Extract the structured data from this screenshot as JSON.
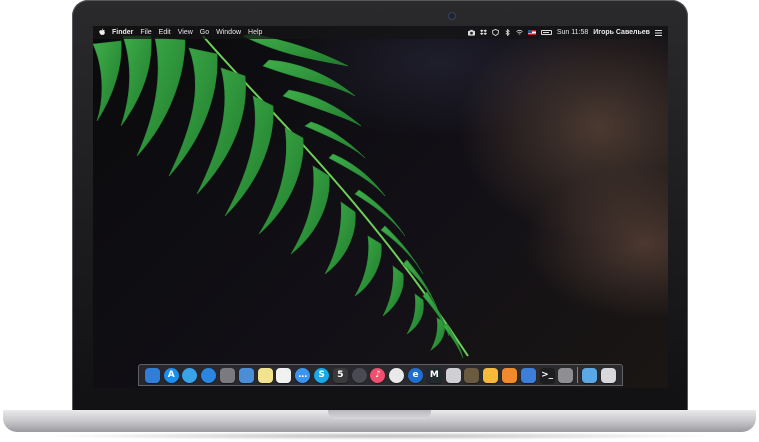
{
  "menubar": {
    "app_name": "Finder",
    "menus": [
      "File",
      "Edit",
      "View",
      "Go",
      "Window",
      "Help"
    ],
    "clock": "Sun 11:58",
    "user_name": "Игорь Савельев",
    "tray_icons": [
      "camera-icon",
      "dropbox-icon",
      "shield-icon",
      "bluetooth-icon",
      "wifi-icon",
      "us-flag-icon",
      "battery-icon",
      "notification-list-icon"
    ]
  },
  "dock": {
    "apps": [
      {
        "name": "finder",
        "label": "",
        "color": "#2f7ed8"
      },
      {
        "name": "app-store",
        "label": "A",
        "color": "#1c8ef0"
      },
      {
        "name": "twitter",
        "label": "",
        "color": "#39a3e8"
      },
      {
        "name": "safari",
        "label": "",
        "color": "#2a86e0"
      },
      {
        "name": "mail-stamp",
        "label": "",
        "color": "#7a7a80"
      },
      {
        "name": "photos-viewer",
        "label": "",
        "color": "#4a8ed8"
      },
      {
        "name": "notes",
        "label": "",
        "color": "#f2e38e"
      },
      {
        "name": "text-edit",
        "label": "",
        "color": "#f1f1f1"
      },
      {
        "name": "messages",
        "label": "…",
        "color": "#3b94ef"
      },
      {
        "name": "skype",
        "label": "S",
        "color": "#1ba7e8"
      },
      {
        "name": "html5",
        "label": "5",
        "color": "#3a3a3a"
      },
      {
        "name": "itunes-circle",
        "label": "",
        "color": "#4a4a52"
      },
      {
        "name": "music",
        "label": "♪",
        "color": "#f0506e"
      },
      {
        "name": "chrome",
        "label": "",
        "color": "#e9e9e9"
      },
      {
        "name": "edge-like",
        "label": "e",
        "color": "#1e6fd0"
      },
      {
        "name": "m-app",
        "label": "M",
        "color": "#1f2a2f"
      },
      {
        "name": "preview",
        "label": "",
        "color": "#d0d0d4"
      },
      {
        "name": "image-viewer",
        "label": "",
        "color": "#6a5a40"
      },
      {
        "name": "sketch",
        "label": "",
        "color": "#f7b93a"
      },
      {
        "name": "transmit",
        "label": "",
        "color": "#f08a2a"
      },
      {
        "name": "xcode",
        "label": "",
        "color": "#3d7fd8"
      },
      {
        "name": "terminal",
        "label": ">_",
        "color": "#1d1d1f"
      },
      {
        "name": "system-preferences",
        "label": "",
        "color": "#8e8e93"
      },
      {
        "name": "downloads-folder",
        "label": "",
        "color": "#5aa8e6"
      },
      {
        "name": "trash",
        "label": "",
        "color": "#d8d8dc"
      }
    ]
  }
}
